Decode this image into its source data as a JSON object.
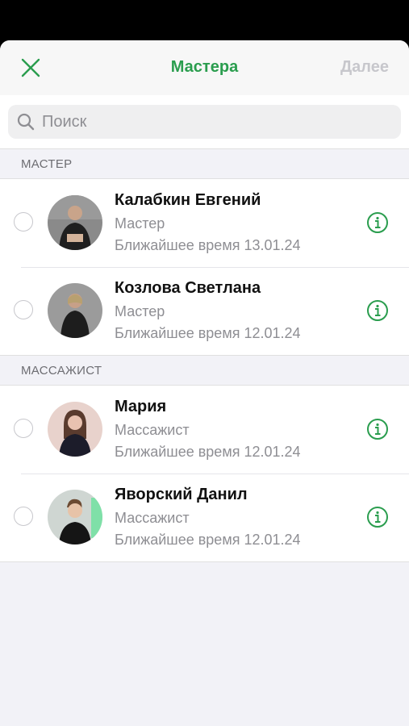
{
  "header": {
    "title": "Мастера",
    "next_label": "Далее",
    "close_icon": "close-icon"
  },
  "search": {
    "placeholder": "Поиск",
    "value": ""
  },
  "colors": {
    "accent": "#2a9d4e",
    "disabled": "#c7c7cc",
    "secondary_text": "#8e8e93"
  },
  "sections": [
    {
      "title": "МАСТЕР",
      "items": [
        {
          "name": "Калабкин Евгений",
          "role": "Мастер",
          "time": "Ближайшее время 13.01.24"
        },
        {
          "name": "Козлова Светлана",
          "role": "Мастер",
          "time": "Ближайшее время 12.01.24"
        }
      ]
    },
    {
      "title": "МАССАЖИСТ",
      "items": [
        {
          "name": "Мария",
          "role": "Массажист",
          "time": "Ближайшее время 12.01.24"
        },
        {
          "name": "Яворский Данил",
          "role": "Массажист",
          "time": "Ближайшее время 12.01.24"
        }
      ]
    }
  ]
}
